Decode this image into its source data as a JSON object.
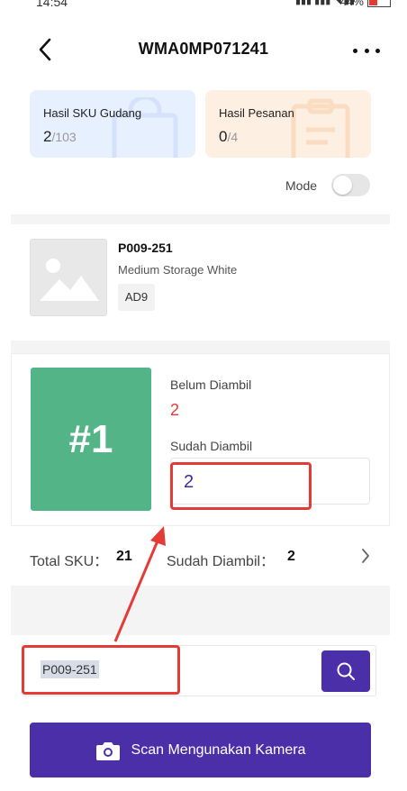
{
  "status_bar": {
    "time": "14:54",
    "battery_text": "44%"
  },
  "header": {
    "title": "WMA0MP071241"
  },
  "cards": {
    "sku": {
      "label": "Hasil SKU Gudang",
      "count": "2",
      "total": "/103"
    },
    "order": {
      "label": "Hasil Pesanan",
      "count": "0",
      "total": "/4"
    }
  },
  "mode": {
    "label": "Mode",
    "enabled": false
  },
  "product": {
    "sku": "P009-251",
    "name": "Medium Storage White",
    "location": "AD9"
  },
  "pick": {
    "rank": "#1",
    "belum_label": "Belum Diambil",
    "belum_value": "2",
    "sudah_label": "Sudah Diambil",
    "sudah_value": "2"
  },
  "summary": {
    "total_label": "Total SKU：",
    "total_value": "21",
    "sudah_label": "Sudah Diambil：",
    "sudah_value": "2"
  },
  "search": {
    "value": "P009-251"
  },
  "camera_button": {
    "label": "Scan Mengunakan Kamera"
  },
  "colors": {
    "accent": "#4b2fa8",
    "success": "#52b487",
    "danger": "#e53935",
    "annotation": "#e53b37"
  }
}
